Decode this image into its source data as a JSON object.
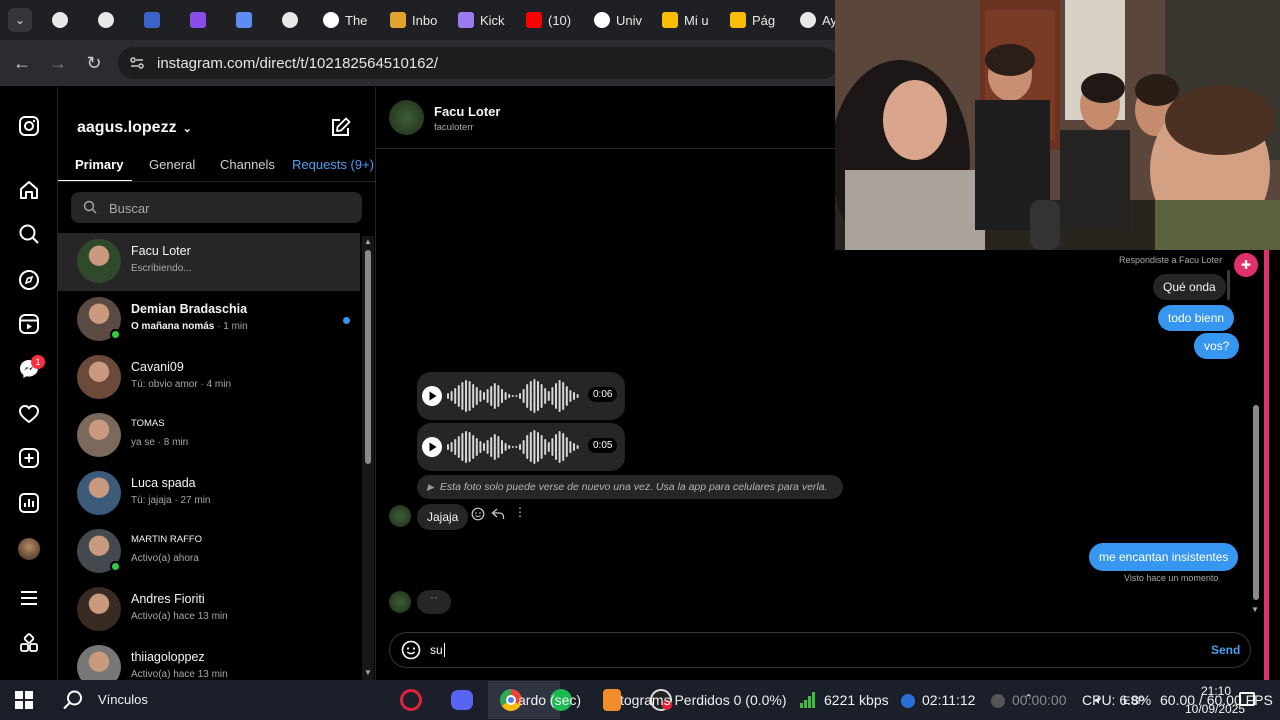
{
  "browser": {
    "tabs": [
      {
        "icon": "chatgpt-icon",
        "label": ""
      },
      {
        "icon": "chatgpt-icon",
        "label": ""
      },
      {
        "icon": "shield-icon",
        "label": ""
      },
      {
        "icon": "s-app-icon",
        "label": ""
      },
      {
        "icon": "gemini-icon",
        "label": ""
      },
      {
        "icon": "chatgpt-icon",
        "label": ""
      },
      {
        "icon": "diamond-icon",
        "label": "The"
      },
      {
        "icon": "mail-icon",
        "label": "Inbo"
      },
      {
        "icon": "kick-icon",
        "label": "Kick"
      },
      {
        "icon": "youtube-icon",
        "label": "(10)"
      },
      {
        "icon": "univ-icon",
        "label": "Univ"
      },
      {
        "icon": "drive-icon",
        "label": "Mi u"
      },
      {
        "icon": "drive-icon",
        "label": "Pág"
      },
      {
        "icon": "chatgpt-icon",
        "label": "Ay"
      }
    ],
    "url": "instagram.com/direct/t/102182564510162/"
  },
  "rail": {
    "notification_count": "1"
  },
  "inbox": {
    "username": "aagus.lopezz",
    "tabs": [
      "Primary",
      "General",
      "Channels",
      "Requests (9+)"
    ],
    "search_placeholder": "Buscar",
    "conversations": [
      {
        "name": "Facu Loter",
        "sub": "Escribiendo...",
        "online": false,
        "unread": false,
        "active": true,
        "avatar_color": "#2f4a2a"
      },
      {
        "name": "Demian Bradaschia",
        "sub_bold": "O mañana nomás",
        "sub": " · 1 min",
        "online": true,
        "unread": true,
        "active": false,
        "avatar_color": "#5a4a42"
      },
      {
        "name": "Cavani09",
        "sub": "Tú: obvio amor · 4 min",
        "online": false,
        "unread": false,
        "active": false,
        "avatar_color": "#6b4a3a"
      },
      {
        "name": "TOMAS",
        "sub": "ya se · 8 min",
        "online": false,
        "unread": false,
        "active": false,
        "avatar_color": "#7a6a5c"
      },
      {
        "name": "Luca spada",
        "sub": "Tú: jajaja · 27 min",
        "online": false,
        "unread": false,
        "active": false,
        "avatar_color": "#3c5a7a"
      },
      {
        "name": "MARTIN RAFFO",
        "sub": "Activo(a) ahora",
        "online": true,
        "unread": false,
        "active": false,
        "avatar_color": "#44484f"
      },
      {
        "name": "Andres Fioriti",
        "sub": "Activo(a) hace 13 min",
        "online": false,
        "unread": false,
        "active": false,
        "avatar_color": "#3a2a24"
      },
      {
        "name": "thiiagoloppez",
        "sub": "Activo(a) hace 13 min",
        "online": false,
        "unread": false,
        "active": false,
        "avatar_color": "#777777"
      }
    ]
  },
  "chat": {
    "contact_name": "Facu Loter",
    "contact_handle": "faculoterr",
    "reply_note": "Respondiste a Facu Loter",
    "messages_out": [
      "Qué onda",
      "todo bienn",
      "vos?"
    ],
    "voice_notes": [
      "0:06",
      "0:05"
    ],
    "view_once_note": "Esta foto solo puede verse de nuevo una vez. Usa la app para celulares para verla.",
    "incoming_text": "Jajaja",
    "last_out": "me encantan insistentes",
    "seen_note": "Visto hace un momento",
    "composer_value": "su",
    "send_label": "Send"
  },
  "taskbar": {
    "search_label": "Vínculos",
    "app_label_1": "ardo (sec)",
    "app_label_2": "tograms Perdidos 0 (0.0%)",
    "bitrate": "6221 kbps",
    "stream_time": "02:11:12",
    "rec_time": "00:00:00",
    "cpu": "CPU: 6.8%",
    "fps": "60.00 / 60.00 FPS",
    "lang": "ESP",
    "time": "21:10",
    "date": "10/09/2025"
  },
  "colors": {
    "accent": "#3797f0",
    "brand_pink": "#e1306c",
    "notification": "#ff3040",
    "online": "#2ecc40"
  }
}
